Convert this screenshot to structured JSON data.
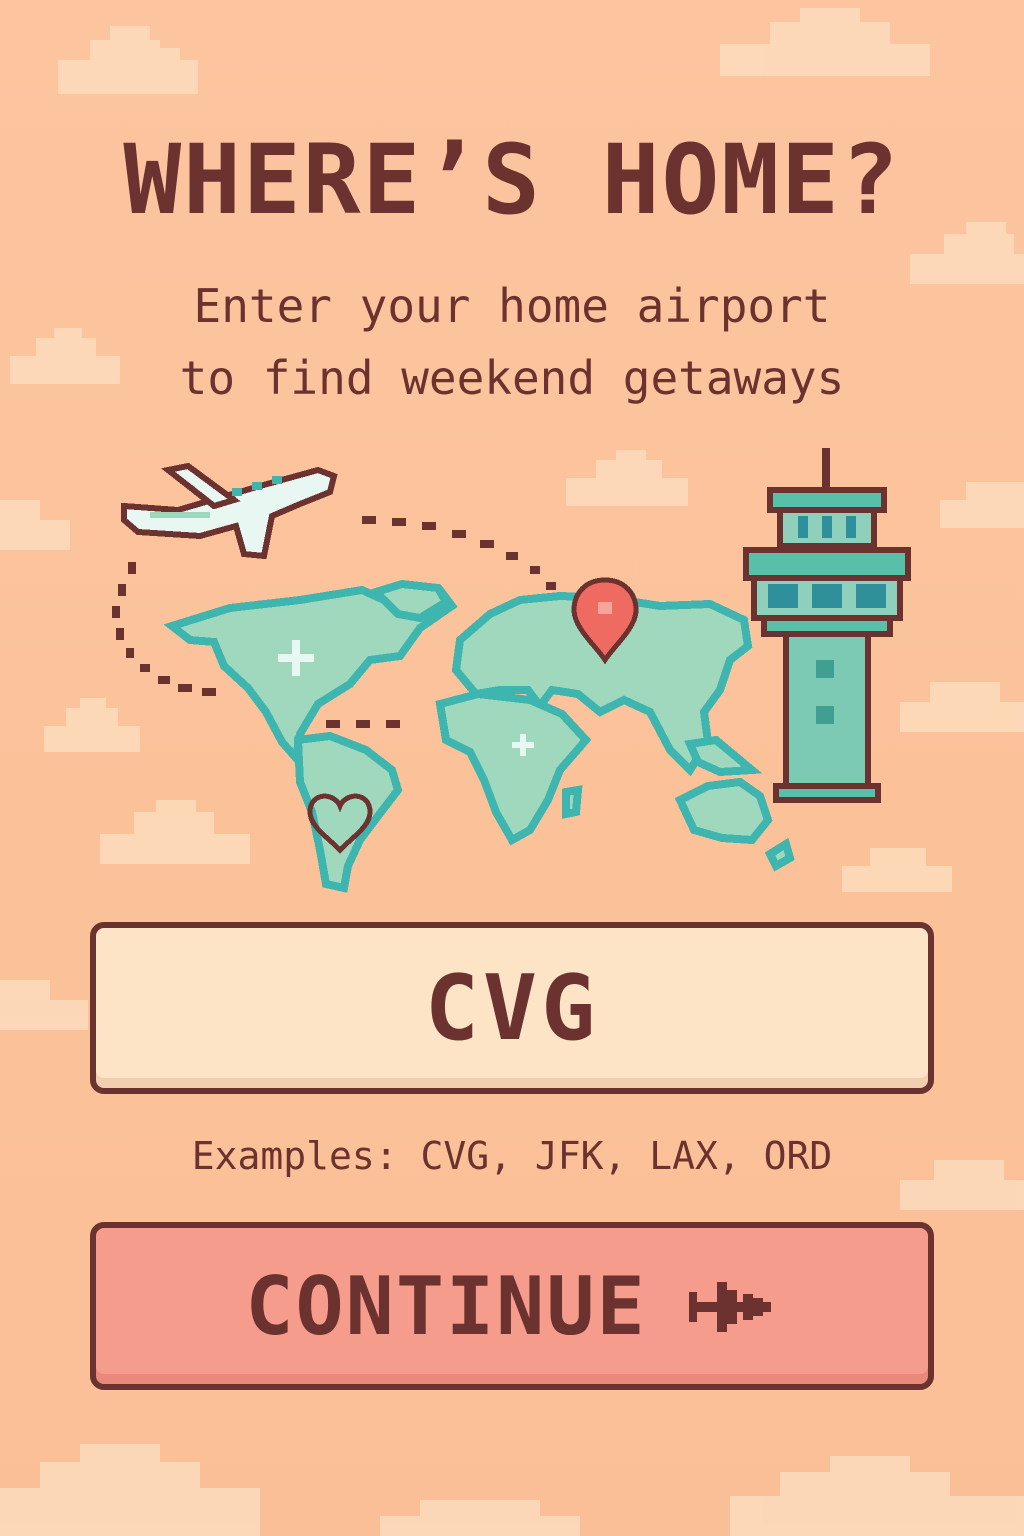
{
  "screen": {
    "title": "WHERE’S HOME?",
    "subtitle_line1": "Enter your home airport",
    "subtitle_line2": "to find weekend getaways"
  },
  "airport_input": {
    "value": "CVG",
    "examples_text": "Examples: CVG, JFK, LAX, ORD"
  },
  "continue_button": {
    "label": "CONTINUE",
    "icon": "airplane-arrow-icon"
  },
  "illustration": {
    "icons": [
      "airplane-icon",
      "world-map",
      "location-pin-icon",
      "heart-icon",
      "control-tower-icon",
      "sparkle-icon"
    ]
  },
  "colors": {
    "background": "#fcc29a",
    "text": "#6b3230",
    "input_fill": "#fde4c6",
    "button_fill": "#f59c8c",
    "map_fill": "#9fd8bd",
    "map_outline": "#3fb5b0",
    "pin": "#ef6b62",
    "cloud": "#fddcbd"
  }
}
